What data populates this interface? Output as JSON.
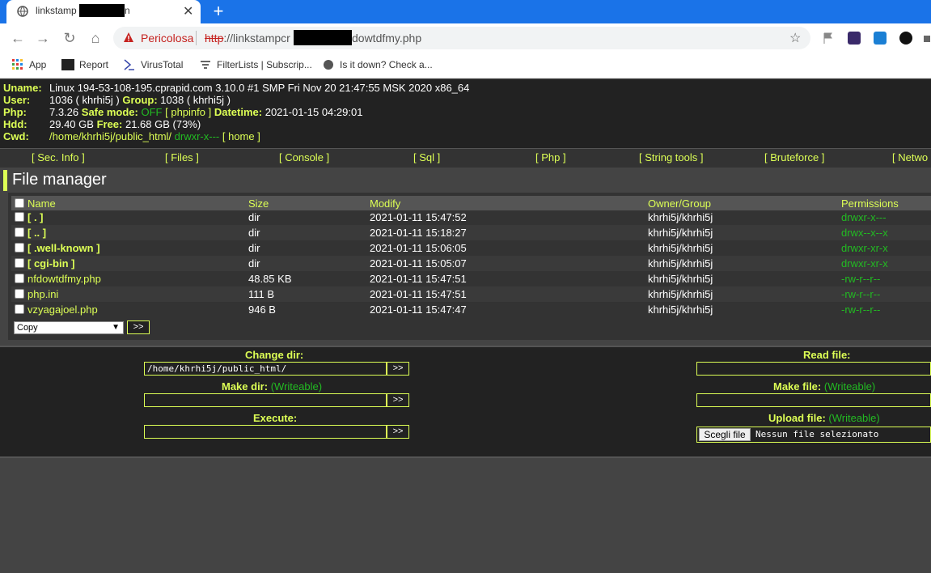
{
  "browser": {
    "tab_title": "linkstamp",
    "tab_title_tail": "n",
    "address": {
      "security_label": "Pericolosa",
      "scheme": "http",
      "url_host": "://linkstampcr",
      "url_tail": "dowtdfmy.php"
    },
    "bookmarks": [
      {
        "label": "App",
        "icon": "apps-grid-icon"
      },
      {
        "label": "Report",
        "icon": "report-icon"
      },
      {
        "label": "VirusTotal",
        "icon": "virustotal-icon"
      },
      {
        "label": "FilterLists | Subscrip...",
        "icon": "filter-icon"
      },
      {
        "label": "Is it down? Check a...",
        "icon": "globe-icon"
      }
    ],
    "colors": {
      "tab_strip": "#1a73e8",
      "danger": "#c5221f"
    }
  },
  "server_info": {
    "uname_label": "Uname:",
    "uname": "Linux 194-53-108-195.cprapid.com 3.10.0 #1 SMP Fri Nov 20 21:47:55 MSK 2020 x86_64",
    "user_label": "User:",
    "user": "1036 ( khrhi5j )",
    "group_label": "Group:",
    "group": "1038 ( khrhi5j )",
    "php_label": "Php:",
    "php": "7.3.26",
    "safe_mode_label": "Safe mode:",
    "safe_mode": "OFF",
    "phpinfo_link": "[ phpinfo ]",
    "datetime_label": "Datetime:",
    "datetime": "2021-01-15 04:29:01",
    "hdd_label": "Hdd:",
    "hdd": "29.40 GB",
    "free_label": "Free:",
    "free": "21.68 GB (73%)",
    "cwd_label": "Cwd:",
    "cwd": "/home/khrhi5j/public_html/",
    "cwd_perms": "drwxr-x---",
    "home_link": "[ home ]"
  },
  "menu": [
    "[ Sec. Info ]",
    "[ Files ]",
    "[ Console ]",
    "[ Sql ]",
    "[ Php ]",
    "[ String tools ]",
    "[ Bruteforce ]",
    "[ Netwo"
  ],
  "file_manager": {
    "title": "File manager",
    "columns": {
      "name": "Name",
      "size": "Size",
      "modify": "Modify",
      "owner": "Owner/Group",
      "perms": "Permissions"
    },
    "rows": [
      {
        "name": "[ . ]",
        "type": "dir",
        "size": "dir",
        "modify": "2021-01-11 15:47:52",
        "owner": "khrhi5j/khrhi5j",
        "perms": "drwxr-x---"
      },
      {
        "name": "[ .. ]",
        "type": "dir",
        "size": "dir",
        "modify": "2021-01-11 15:18:27",
        "owner": "khrhi5j/khrhi5j",
        "perms": "drwx--x--x"
      },
      {
        "name": "[ .well-known ]",
        "type": "dir",
        "size": "dir",
        "modify": "2021-01-11 15:06:05",
        "owner": "khrhi5j/khrhi5j",
        "perms": "drwxr-xr-x"
      },
      {
        "name": "[ cgi-bin ]",
        "type": "dir",
        "size": "dir",
        "modify": "2021-01-11 15:05:07",
        "owner": "khrhi5j/khrhi5j",
        "perms": "drwxr-xr-x"
      },
      {
        "name": "nfdowtdfmy.php",
        "type": "file",
        "size": "48.85 KB",
        "modify": "2021-01-11 15:47:51",
        "owner": "khrhi5j/khrhi5j",
        "perms": "-rw-r--r--"
      },
      {
        "name": "php.ini",
        "type": "file",
        "size": "111 B",
        "modify": "2021-01-11 15:47:51",
        "owner": "khrhi5j/khrhi5j",
        "perms": "-rw-r--r--"
      },
      {
        "name": "vzyagajoel.php",
        "type": "file",
        "size": "946 B",
        "modify": "2021-01-11 15:47:47",
        "owner": "khrhi5j/khrhi5j",
        "perms": "-rw-r--r--"
      }
    ],
    "action_select": "Copy",
    "go_label": ">>"
  },
  "forms": {
    "change_dir_label": "Change dir:",
    "change_dir_value": "/home/khrhi5j/public_html/",
    "make_dir_label": "Make dir:",
    "writeable": "(Writeable)",
    "execute_label": "Execute:",
    "read_file_label": "Read file:",
    "make_file_label": "Make file:",
    "upload_file_label": "Upload file:",
    "choose_file": "Scegli file",
    "no_file": "Nessun file selezionato",
    "go_label": ">>"
  }
}
